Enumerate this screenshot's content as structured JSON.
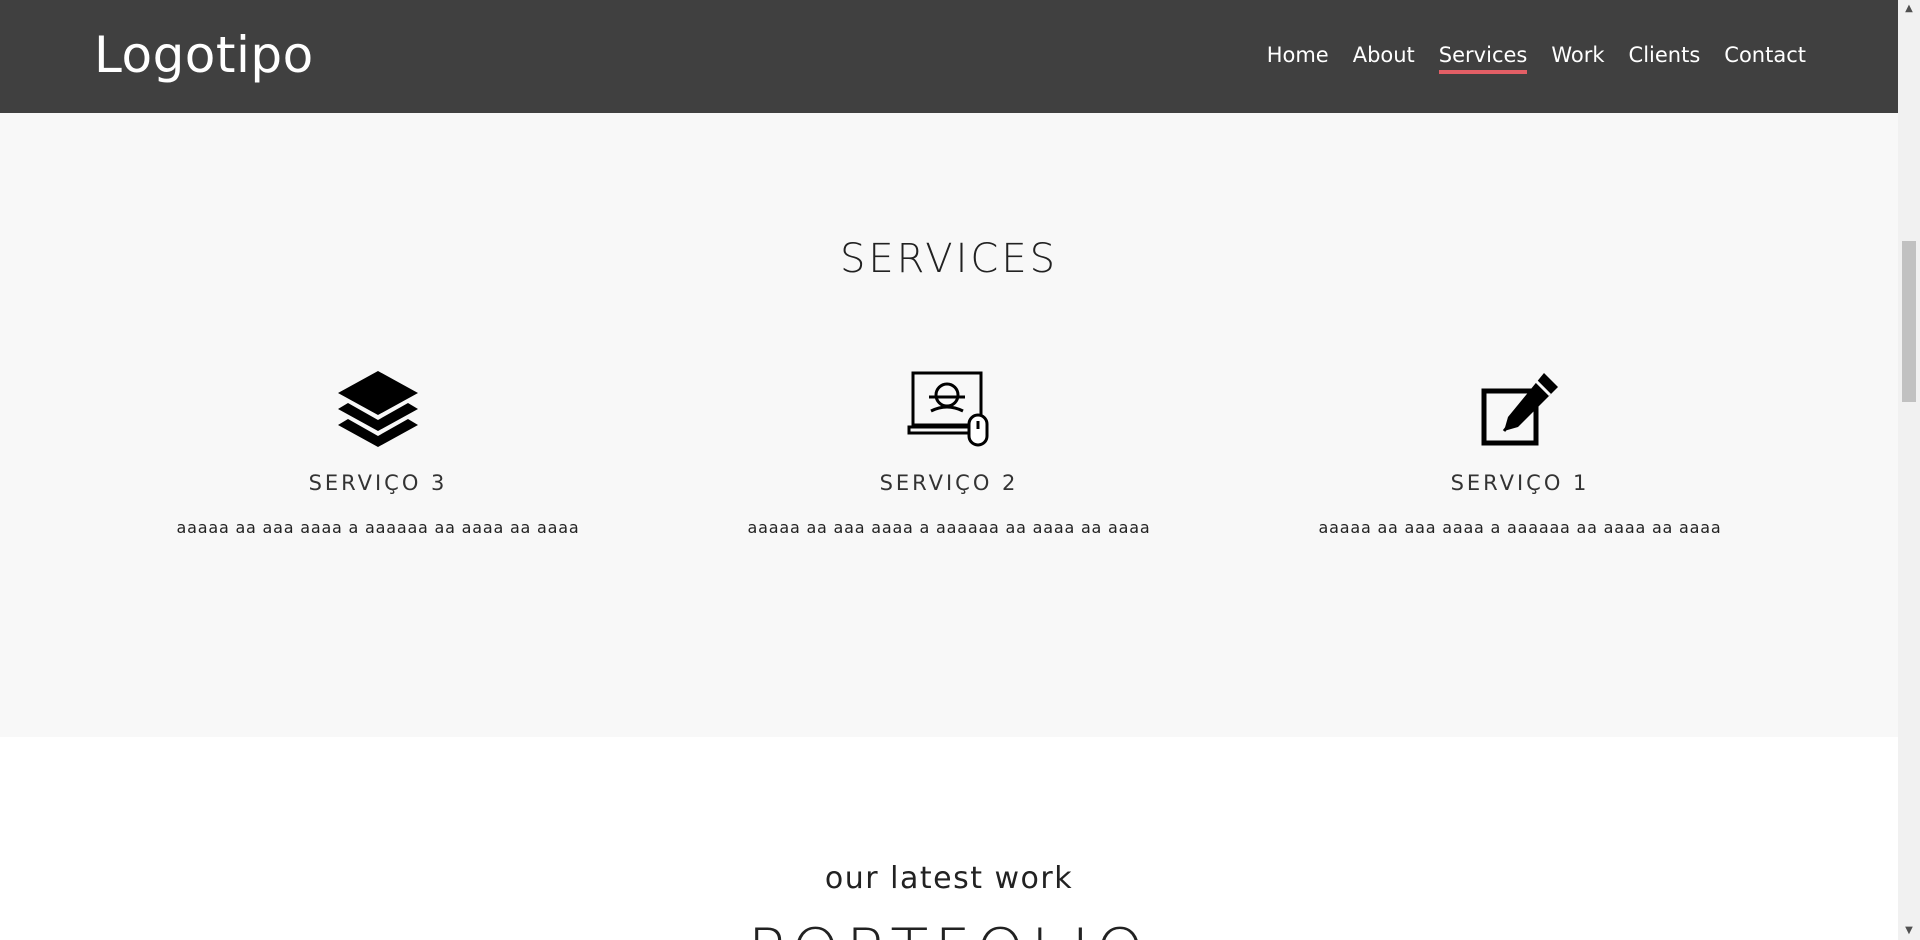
{
  "header": {
    "logo": "Logotipo",
    "nav": [
      {
        "label": "Home"
      },
      {
        "label": "About"
      },
      {
        "label": "Services",
        "active": true
      },
      {
        "label": "Work"
      },
      {
        "label": "Clients"
      },
      {
        "label": "Contact"
      }
    ],
    "accent_color": "#e35f66",
    "background_color": "#404040"
  },
  "services": {
    "title": "SERVICES",
    "items": [
      {
        "icon": "layers-icon",
        "name": "SERVIÇO 3",
        "description": "aaaaa aa aaa aaaa a aaaaaa aa aaaa aa aaaa"
      },
      {
        "icon": "computer-design-icon",
        "name": "SERVIÇO 2",
        "description": "aaaaa aa aaa aaaa a aaaaaa aa aaaa aa aaaa"
      },
      {
        "icon": "edit-icon",
        "name": "SERVIÇO 1",
        "description": "aaaaa aa aaa aaaa a aaaaaa aa aaaa aa aaaa"
      }
    ]
  },
  "portfolio": {
    "subtitle": "our latest work",
    "title": "PORTFOLIO"
  },
  "scrollbar": {
    "up_arrow": "▲",
    "down_arrow": "▼"
  }
}
